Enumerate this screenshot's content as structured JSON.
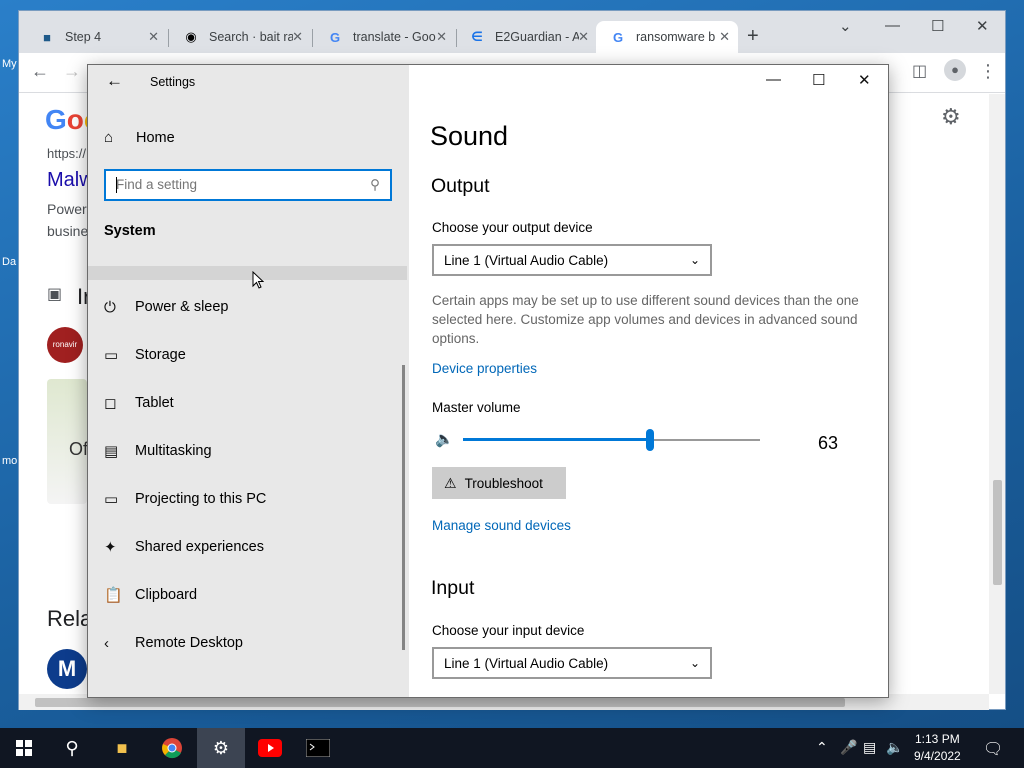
{
  "desktop": {
    "icons": [
      "My",
      "Da",
      "mo"
    ]
  },
  "browser": {
    "tabs": [
      {
        "title": "Step 4",
        "favicon": "step-icon"
      },
      {
        "title": "Search · bait ra",
        "favicon": "github-icon"
      },
      {
        "title": "translate - Goo",
        "favicon": "google-icon"
      },
      {
        "title": "E2Guardian - A",
        "favicon": "e2guardian-icon"
      },
      {
        "title": "ransomware b",
        "favicon": "google-icon"
      }
    ],
    "page": {
      "logo": "Goo",
      "url_fragment": "https://",
      "result_title": "Malw",
      "snippet_line1": "Power",
      "snippet_line2": "busine",
      "images_heading": "Ir",
      "thumb_label": "ronavir",
      "office_label": "Of",
      "related_heading": "Rela"
    }
  },
  "settings": {
    "window_title": "Settings",
    "home_label": "Home",
    "search_placeholder": "Find a setting",
    "section": "System",
    "nav": [
      {
        "label": "Power & sleep",
        "icon": "power-icon"
      },
      {
        "label": "Storage",
        "icon": "storage-icon"
      },
      {
        "label": "Tablet",
        "icon": "tablet-icon"
      },
      {
        "label": "Multitasking",
        "icon": "multitasking-icon"
      },
      {
        "label": "Projecting to this PC",
        "icon": "projecting-icon"
      },
      {
        "label": "Shared experiences",
        "icon": "shared-experiences-icon"
      },
      {
        "label": "Clipboard",
        "icon": "clipboard-icon"
      },
      {
        "label": "Remote Desktop",
        "icon": "remote-desktop-icon"
      }
    ],
    "page_title": "Sound",
    "output": {
      "heading": "Output",
      "device_label": "Choose your output device",
      "device_value": "Line 1 (Virtual Audio Cable)",
      "description": "Certain apps may be set up to use different sound devices than the one selected here. Customize app volumes and devices in advanced sound options.",
      "device_properties_link": "Device properties",
      "master_volume_label": "Master volume",
      "master_volume_value": "63",
      "troubleshoot_label": "Troubleshoot",
      "manage_link": "Manage sound devices"
    },
    "input": {
      "heading": "Input",
      "device_label": "Choose your input device",
      "device_value": "Line 1 (Virtual Audio Cable)"
    }
  },
  "taskbar": {
    "apps": [
      "file-explorer-icon",
      "chrome-icon",
      "settings-icon",
      "youtube-icon",
      "terminal-icon"
    ],
    "time": "1:13 PM",
    "date": "9/4/2022"
  },
  "colors": {
    "accent": "#0078d7",
    "link": "#0067b8",
    "taskbar": "#101622",
    "sidebar": "#e8e8e8"
  }
}
